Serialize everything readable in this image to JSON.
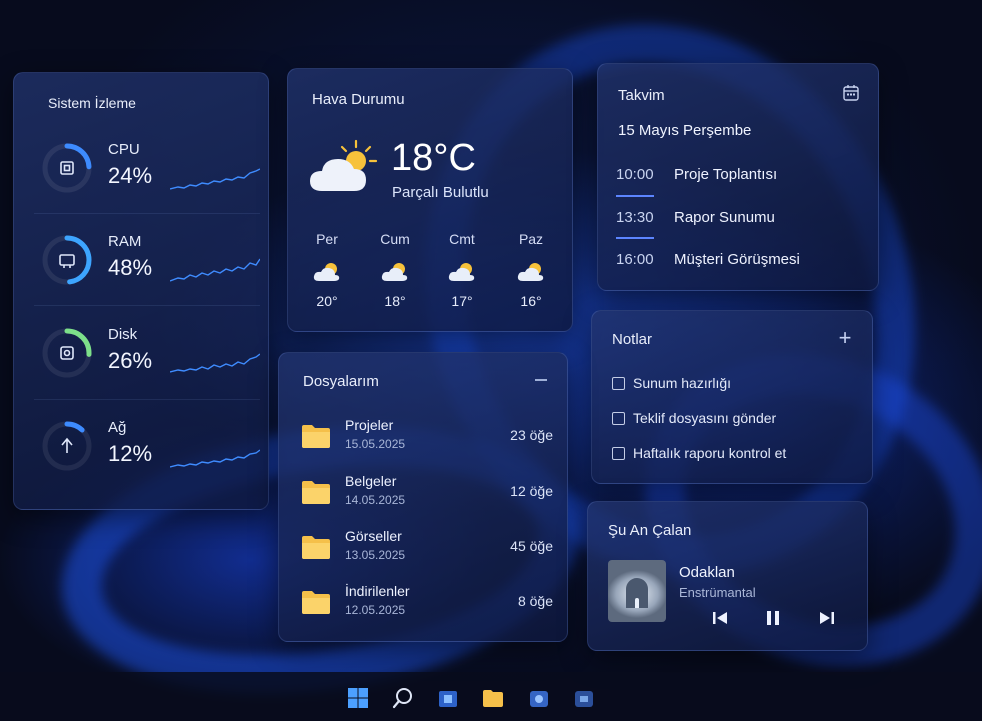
{
  "system_monitor": {
    "title": "Sistem İzleme",
    "metrics": [
      {
        "label": "CPU",
        "value": "24%",
        "fraction": 0.24,
        "icon": "cpu-icon",
        "color": "#3d8bff"
      },
      {
        "label": "RAM",
        "value": "48%",
        "fraction": 0.48,
        "icon": "memory-icon",
        "color": "#3da5ff"
      },
      {
        "label": "Disk",
        "value": "26%",
        "fraction": 0.26,
        "icon": "disk-icon",
        "color": "#7de08a"
      },
      {
        "label": "Ağ",
        "value": "12%",
        "fraction": 0.12,
        "icon": "network-icon",
        "color": "#3d8bff"
      }
    ]
  },
  "weather": {
    "title": "Hava Durumu",
    "temperature": "18°C",
    "condition": "Parçalı Bulutlu",
    "icon": "partly-cloudy-icon",
    "forecast": [
      {
        "day": "Per",
        "temp": "20°"
      },
      {
        "day": "Cum",
        "temp": "18°"
      },
      {
        "day": "Cmt",
        "temp": "17°"
      },
      {
        "day": "Paz",
        "temp": "16°"
      }
    ]
  },
  "calendar": {
    "title": "Takvim",
    "date": "15 Mayıs Perşembe",
    "events": [
      {
        "time": "10:00",
        "name": "Proje Toplantısı"
      },
      {
        "time": "13:30",
        "name": "Rapor Sunumu"
      },
      {
        "time": "16:00",
        "name": "Müşteri Görüşmesi"
      }
    ]
  },
  "notes": {
    "title": "Notlar",
    "add_label": "+",
    "items": [
      "Sunum hazırlığı",
      "Teklif dosyasını gönder",
      "Haftalık raporu kontrol et"
    ]
  },
  "files": {
    "title": "Dosyalarım",
    "items": [
      {
        "name": "Projeler",
        "date": "15.05.2025",
        "count": "23 öğe"
      },
      {
        "name": "Belgeler",
        "date": "14.05.2025",
        "count": "12 öğe"
      },
      {
        "name": "Görseller",
        "date": "13.05.2025",
        "count": "45 öğe"
      },
      {
        "name": "İndirilenler",
        "date": "12.05.2025",
        "count": "8 öğe"
      }
    ]
  },
  "player": {
    "title": "Şu An Çalan",
    "song": "Odaklan",
    "artist": "Enstrümantal"
  },
  "colors": {
    "accent": "#3d8bff",
    "folder": "#f5c04a",
    "sun": "#f7c23b"
  },
  "taskbar": {
    "icons": [
      "start-icon",
      "search-icon",
      "store-icon",
      "file-explorer-icon",
      "app-icon",
      "app-icon"
    ]
  }
}
